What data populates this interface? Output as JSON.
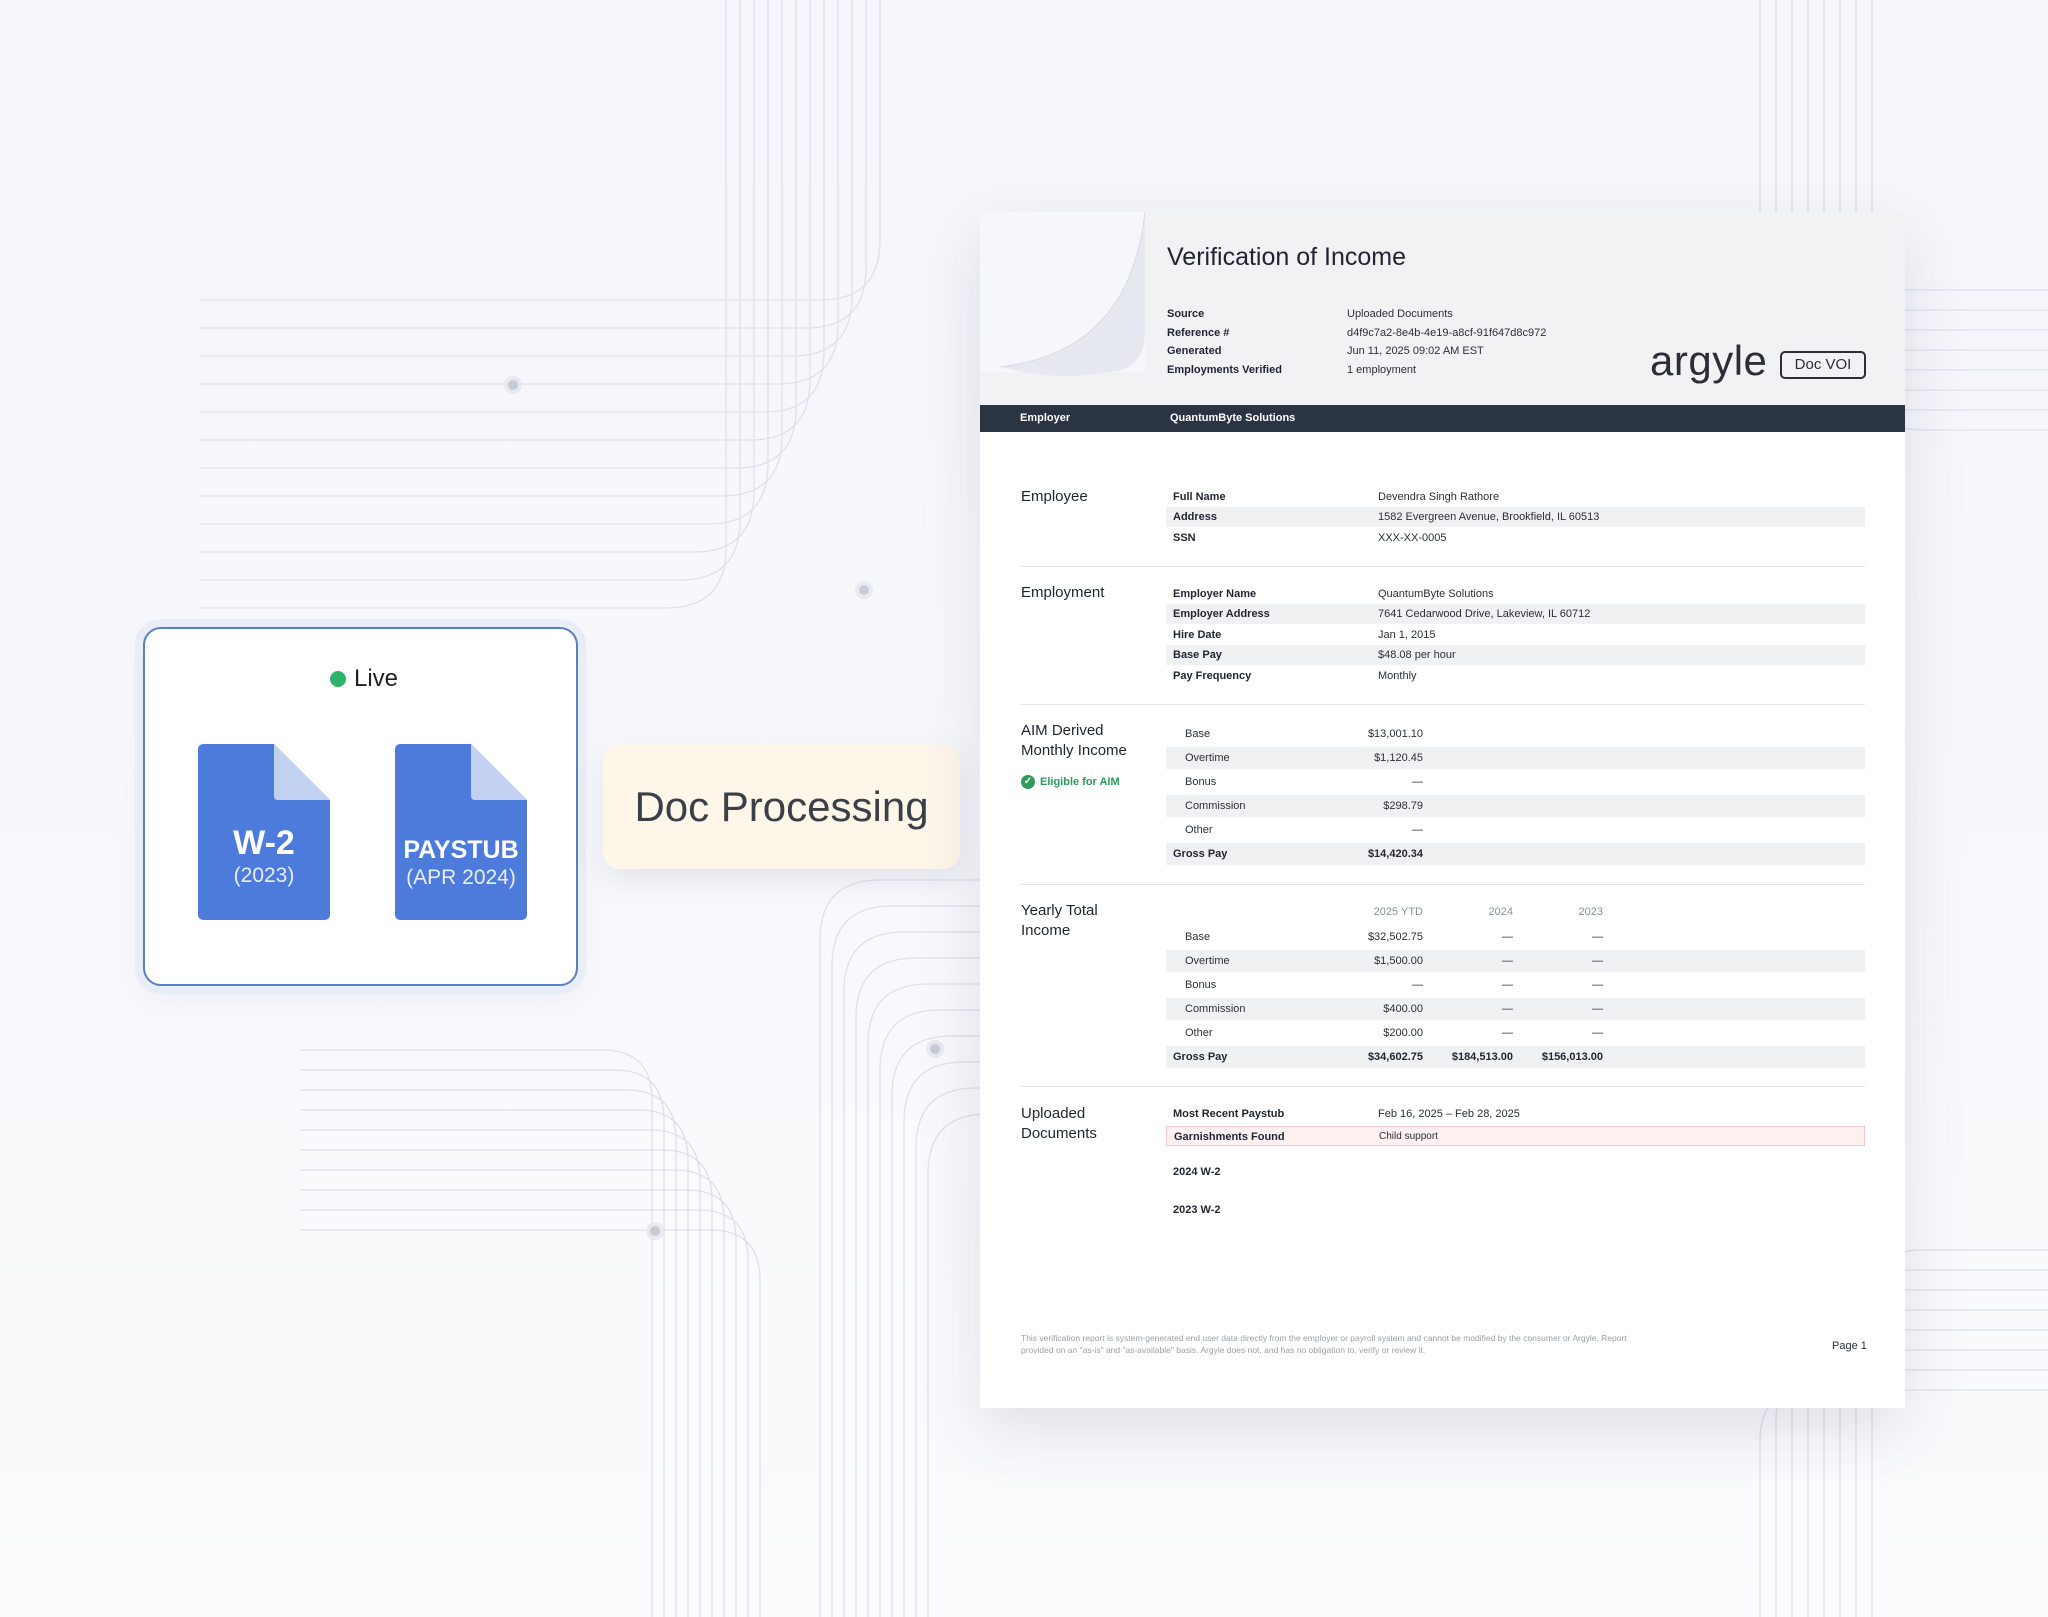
{
  "live_card": {
    "status": "Live",
    "status_color": "#2fb36b",
    "files": [
      {
        "title": "W-2",
        "subtitle": "(2023)",
        "icon": "document-icon",
        "color": "#4c7bdb"
      },
      {
        "title": "PAYSTUB",
        "subtitle": "(APR 2024)",
        "icon": "document-icon",
        "color": "#4c7bdb"
      }
    ]
  },
  "processing": {
    "label": "Doc Processing"
  },
  "report": {
    "title": "Verification of Income",
    "meta": [
      {
        "key": "Source",
        "value": "Uploaded Documents"
      },
      {
        "key": "Reference #",
        "value": "d4f9c7a2-8e4b-4e19-a8cf-91f647d8c972"
      },
      {
        "key": "Generated",
        "value": "Jun 11, 2025 09:02 AM EST"
      },
      {
        "key": "Employments Verified",
        "value": "1 employment"
      }
    ],
    "brand": "argyle",
    "badge": "Doc VOI",
    "employer_bar": {
      "label": "Employer",
      "value": "QuantumByte Solutions"
    },
    "employee": {
      "title": "Employee",
      "rows": [
        {
          "key": "Full Name",
          "value": "Devendra Singh Rathore"
        },
        {
          "key": "Address",
          "value": "1582 Evergreen Avenue, Brookfield, IL 60513"
        },
        {
          "key": "SSN",
          "value": "XXX-XX-0005"
        }
      ]
    },
    "employment": {
      "title": "Employment",
      "rows": [
        {
          "key": "Employer Name",
          "value": "QuantumByte Solutions"
        },
        {
          "key": "Employer Address",
          "value": "7641 Cedarwood Drive, Lakeview, IL 60712"
        },
        {
          "key": "Hire Date",
          "value": "Jan 1, 2015"
        },
        {
          "key": "Base Pay",
          "value": "$48.08 per hour"
        },
        {
          "key": "Pay Frequency",
          "value": "Monthly"
        }
      ]
    },
    "aim": {
      "title_line1": "AIM Derived",
      "title_line2": "Monthly Income",
      "eligible": "Eligible for AIM",
      "eligible_color": "#2e9a5b",
      "rows": [
        {
          "label": "Base",
          "value": "$13,001.10"
        },
        {
          "label": "Overtime",
          "value": "$1,120.45"
        },
        {
          "label": "Bonus",
          "value": "—"
        },
        {
          "label": "Commission",
          "value": "$298.79"
        },
        {
          "label": "Other",
          "value": "—"
        },
        {
          "label": "Gross Pay",
          "value": "$14,420.34"
        }
      ]
    },
    "yearly": {
      "title_line1": "Yearly Total",
      "title_line2": "Income",
      "columns": [
        "2025 YTD",
        "2024",
        "2023"
      ],
      "rows": [
        {
          "label": "Base",
          "values": [
            "$32,502.75",
            "—",
            "—"
          ]
        },
        {
          "label": "Overtime",
          "values": [
            "$1,500.00",
            "—",
            "—"
          ]
        },
        {
          "label": "Bonus",
          "values": [
            "—",
            "—",
            "—"
          ]
        },
        {
          "label": "Commission",
          "values": [
            "$400.00",
            "—",
            "—"
          ]
        },
        {
          "label": "Other",
          "values": [
            "$200.00",
            "—",
            "—"
          ]
        },
        {
          "label": "Gross Pay",
          "values": [
            "$34,602.75",
            "$184,513.00",
            "$156,013.00"
          ]
        }
      ]
    },
    "uploaded": {
      "title_line1": "Uploaded",
      "title_line2": "Documents",
      "rows": [
        {
          "key": "Most Recent Paystub",
          "value": "Feb 16, 2025 – Feb 28, 2025"
        },
        {
          "key": "Garnishments Found",
          "value": "Child support"
        }
      ],
      "docs": [
        "2024 W-2",
        "2023 W-2"
      ]
    },
    "footer": {
      "disclaimer": "This verification report is system-generated end user data directly from the employer or payroll system and cannot be modified by the consumer or Argyle. Report provided on an \"as-is\" and \"as-available\" basis. Argyle does not, and has no obligation to, verify or review it.",
      "page": "Page 1"
    }
  }
}
